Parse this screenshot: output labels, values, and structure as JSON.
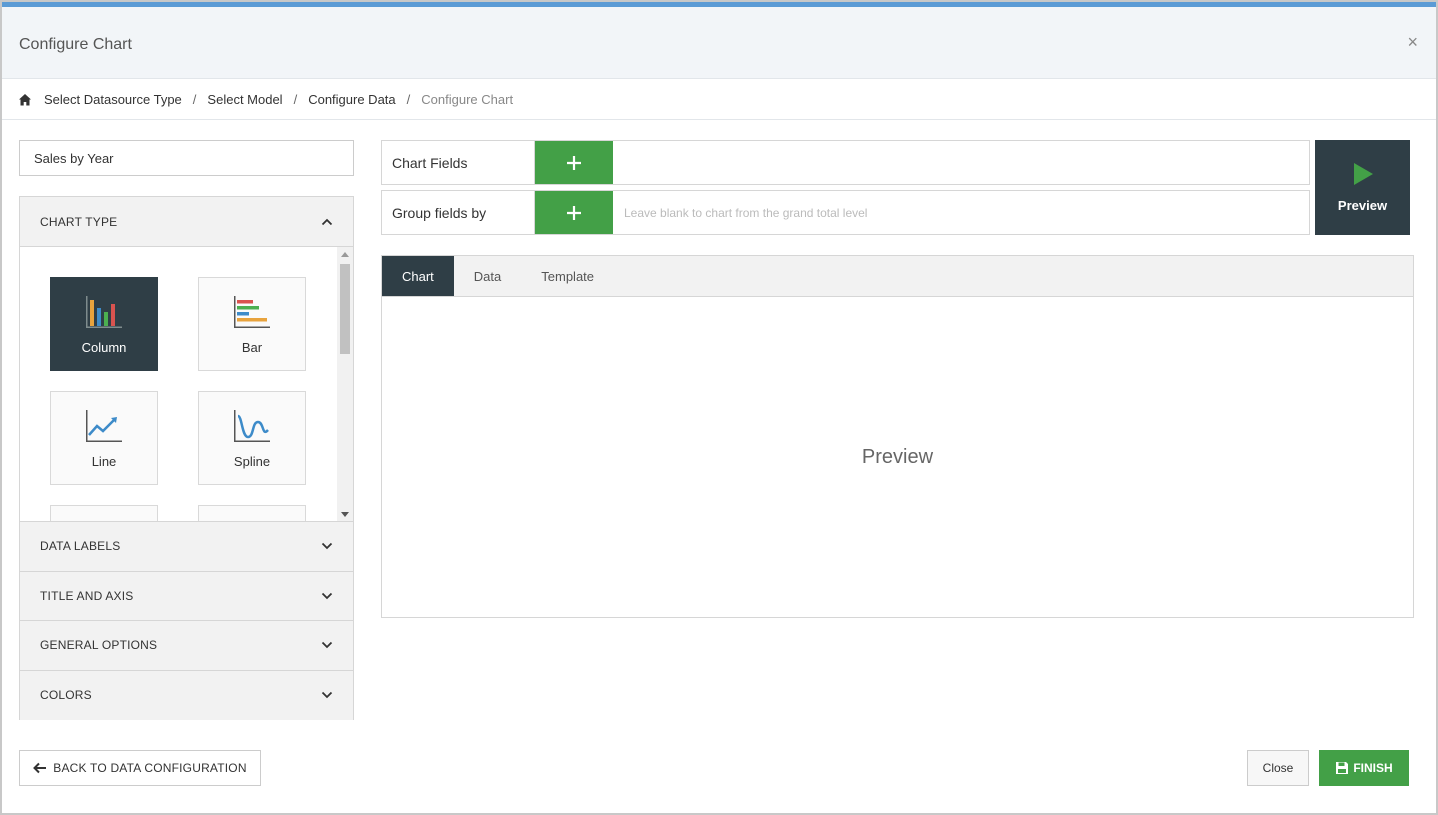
{
  "dialog": {
    "title": "Configure Chart",
    "close_glyph": "×"
  },
  "breadcrumb": {
    "items": [
      {
        "label": "Select Datasource Type"
      },
      {
        "label": "Select Model"
      },
      {
        "label": "Configure Data"
      },
      {
        "label": "Configure Chart",
        "active": true
      }
    ],
    "separator": "/"
  },
  "chart_name": {
    "value": "Sales by Year"
  },
  "sections": {
    "chart_type": "CHART TYPE",
    "data_labels": "DATA LABELS",
    "title_and_axis": "TITLE AND AXIS",
    "general_options": "GENERAL OPTIONS",
    "colors": "COLORS"
  },
  "chart_types": [
    {
      "label": "Column",
      "icon": "column-chart-icon",
      "selected": true
    },
    {
      "label": "Bar",
      "icon": "bar-chart-icon",
      "selected": false
    },
    {
      "label": "Line",
      "icon": "line-chart-icon",
      "selected": false
    },
    {
      "label": "Spline",
      "icon": "spline-chart-icon",
      "selected": false
    }
  ],
  "fields": {
    "chart_fields_label": "Chart Fields",
    "group_fields_label": "Group fields by",
    "group_placeholder": "Leave blank to chart from the grand total level",
    "add_glyph": "+"
  },
  "preview_button": {
    "label": "Preview"
  },
  "tabs": [
    {
      "label": "Chart",
      "active": true
    },
    {
      "label": "Data",
      "active": false
    },
    {
      "label": "Template",
      "active": false
    }
  ],
  "preview_area": {
    "text": "Preview"
  },
  "footer": {
    "back_label": "BACK TO DATA CONFIGURATION",
    "close_label": "Close",
    "finish_label": "FINISH"
  },
  "colors": {
    "accent_dark": "#2f3e46",
    "accent_green": "#43a047",
    "top_bar": "#5b9bd5"
  }
}
